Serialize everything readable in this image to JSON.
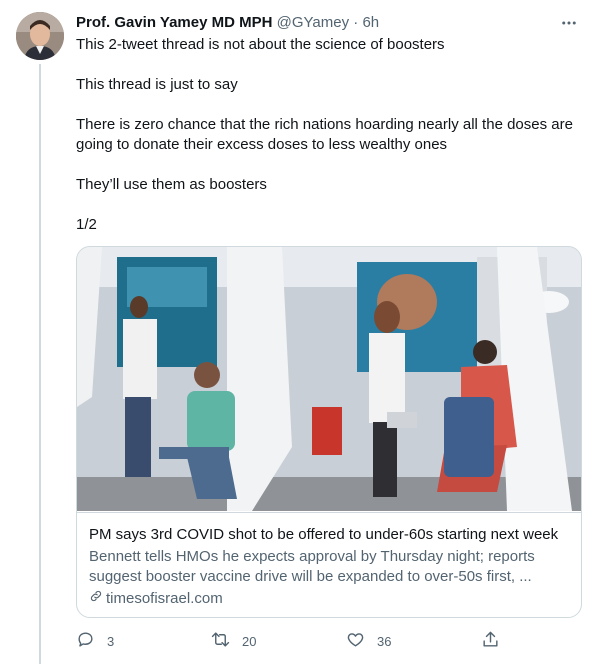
{
  "tweet": {
    "author_name": "Prof. Gavin Yamey MD MPH",
    "handle": "@GYamey",
    "separator": "·",
    "time": "6h",
    "paragraphs": [
      "This 2-tweet thread is not about the science of boosters",
      "This thread is just to say",
      "There is zero chance that the rich nations hoarding nearly all the doses are going to donate their excess doses to less wealthy ones",
      "They’ll use them as boosters",
      "1/2"
    ]
  },
  "card": {
    "title": "PM says 3rd COVID shot to be offered to under-60s starting next week",
    "description": "Bennett tells HMOs he expects approval by Thursday night; reports suggest booster vaccine drive will be expanded to over-50s first, ...",
    "domain": "timesofisrael.com",
    "image_alt": "People receiving vaccine shots at a vaccination center with white curtains and Pfizer banners"
  },
  "actions": {
    "reply_count": "3",
    "retweet_count": "20",
    "like_count": "36"
  },
  "icons": {
    "more": "more-icon",
    "reply": "reply-icon",
    "retweet": "retweet-icon",
    "like": "like-icon",
    "share": "share-icon",
    "link": "link-icon"
  },
  "colors": {
    "primary_text": "#0f1419",
    "secondary_text": "#536471",
    "border": "#cfd9de"
  }
}
